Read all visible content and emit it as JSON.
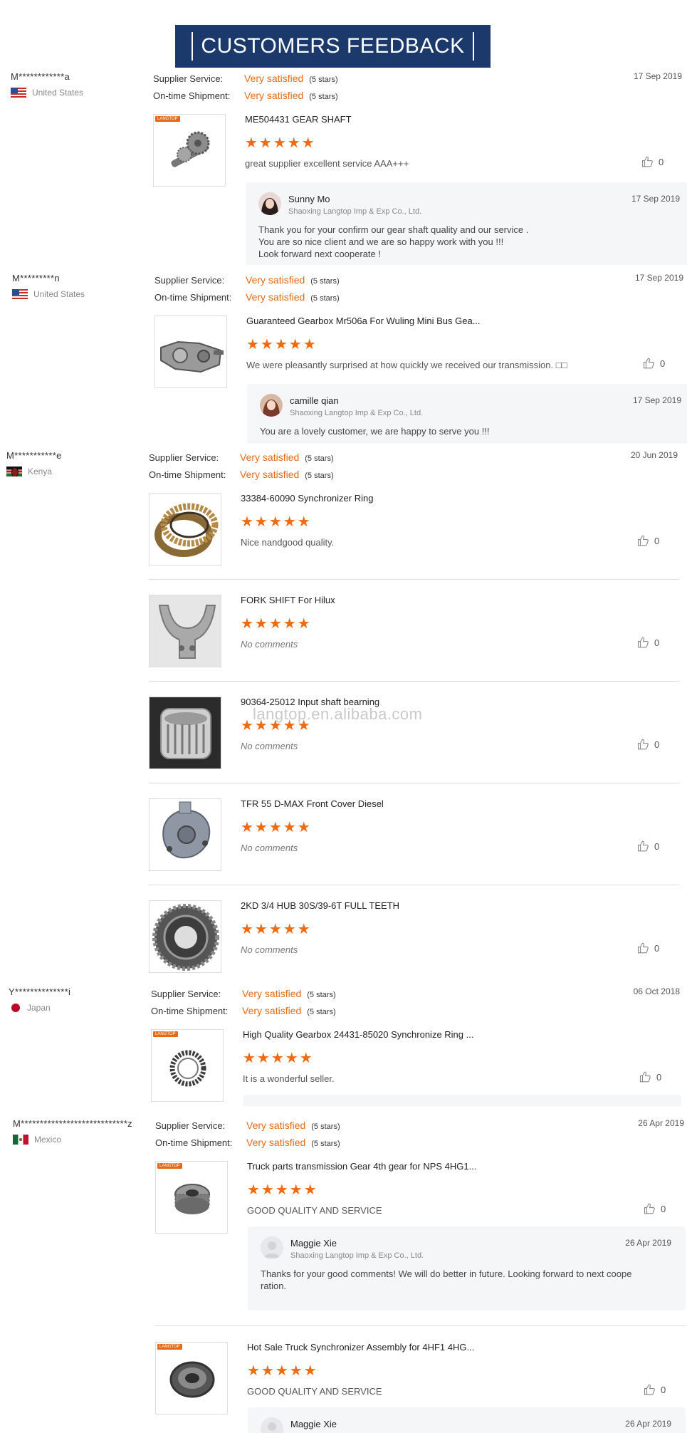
{
  "banner": {
    "title": "CUSTOMERS FEEDBACK"
  },
  "labels": {
    "supplier_service": "Supplier Service:",
    "ontime_shipment": "On-time Shipment:",
    "very_satisfied": "Very satisfied",
    "five_stars": "(5 stars)"
  },
  "watermark": "langtop.en.alibaba.com",
  "reviews": [
    {
      "buyer": "M************a",
      "country": "United States",
      "date": "17 Sep 2019",
      "products": [
        {
          "name": "ME504431 GEAR SHAFT",
          "comment": "great supplier excellent service AAA+++",
          "helpful": "0",
          "rating": 5
        }
      ],
      "reply": {
        "name": "Sunny Mo",
        "company": "Shaoxing Langtop Imp & Exp Co., Ltd.",
        "date": "17 Sep 2019",
        "text": "Thank you for your confirm our gear shaft quality and our service .\nYou are so nice client and we are so happy work with you !!!\nLook forward next cooperate !"
      }
    },
    {
      "buyer": "M*********n",
      "country": "United States",
      "date": "17 Sep 2019",
      "products": [
        {
          "name": "Guaranteed Gearbox Mr506a For Wuling Mini Bus Gea...",
          "comment": "We were pleasantly surprised at how quickly we received our transmission. □□",
          "helpful": "0",
          "rating": 5
        }
      ],
      "reply": {
        "name": "camille qian",
        "company": "Shaoxing Langtop Imp & Exp Co., Ltd.",
        "date": "17 Sep 2019",
        "text": "You are a lovely customer, we are happy to serve you !!!"
      }
    },
    {
      "buyer": "M***********e",
      "country": "Kenya",
      "date": "20 Jun 2019",
      "products": [
        {
          "name": "33384-60090 Synchronizer Ring",
          "comment": "Nice nandgood quality.",
          "helpful": "0",
          "rating": 5
        },
        {
          "name": "FORK SHIFT For Hilux",
          "comment": "No comments",
          "helpful": "0",
          "rating": 5
        },
        {
          "name": "90364-25012 Input shaft bearning",
          "comment": "No comments",
          "helpful": "0",
          "rating": 5
        },
        {
          "name": "TFR 55 D-MAX Front Cover Diesel",
          "comment": "No comments",
          "helpful": "0",
          "rating": 5
        },
        {
          "name": "2KD 3/4 HUB 30S/39-6T FULL TEETH",
          "comment": "No comments",
          "helpful": "0",
          "rating": 5
        }
      ]
    },
    {
      "buyer": "Y**************i",
      "country": "Japan",
      "date": "06 Oct 2018",
      "products": [
        {
          "name": "High Quality Gearbox 24431-85020 Synchronize Ring ...",
          "comment": "It is a wonderful seller.",
          "helpful": "0",
          "rating": 5
        }
      ]
    },
    {
      "buyer": "M****************************z",
      "country": "Mexico",
      "date": "26 Apr 2019",
      "products": [
        {
          "name": "Truck parts transmission Gear 4th gear for NPS 4HG1...",
          "comment": "GOOD QUALITY AND SERVICE",
          "helpful": "0",
          "rating": 5
        },
        {
          "name": "Hot Sale Truck Synchronizer Assembly for 4HF1 4HG...",
          "comment": "GOOD QUALITY AND SERVICE",
          "helpful": "0",
          "rating": 5
        }
      ],
      "reply": {
        "name": "Maggie Xie",
        "company": "Shaoxing Langtop Imp & Exp Co., Ltd.",
        "date": "26 Apr 2019",
        "text": "Thanks for your good comments! We will do better in future. Looking forward to next coope\nration."
      },
      "reply2": {
        "name": "Maggie Xie",
        "date": "26 Apr 2019"
      }
    }
  ]
}
